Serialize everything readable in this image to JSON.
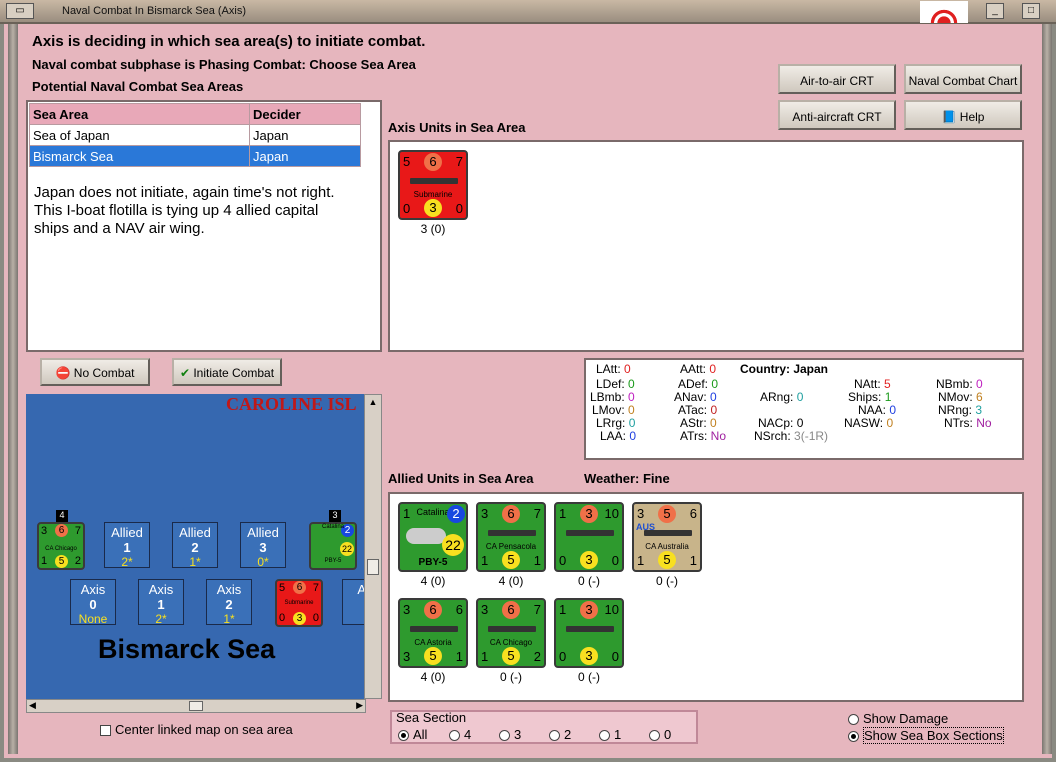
{
  "window": {
    "title": "Naval Combat In Bismarck Sea (Axis)"
  },
  "header": {
    "line1": "Axis is deciding in which sea area(s) to initiate combat.",
    "line2": "Naval combat subphase is Phasing Combat: Choose Sea Area",
    "line3": "Potential Naval Combat Sea Areas"
  },
  "buttons": {
    "air_to_air": "Air-to-air CRT",
    "naval_chart": "Naval Combat Chart",
    "anti_aircraft": "Anti-aircraft CRT",
    "help": "Help",
    "no_combat": "No Combat",
    "initiate": "Initiate Combat"
  },
  "sea_table": {
    "headers": [
      "Sea Area",
      "Decider"
    ],
    "rows": [
      [
        "Sea of Japan",
        "Japan"
      ],
      [
        "Bismarck Sea",
        "Japan"
      ]
    ]
  },
  "note": "Japan does not initiate, again time's not right.  This I-boat flotilla is tying up 4 allied capital ships and a NAV air wing.",
  "axis_units": {
    "label": "Axis Units in Sea Area",
    "sub": {
      "top": [
        "5",
        "6",
        "7"
      ],
      "name": "Submarine",
      "bottom": [
        "0",
        "3",
        "0"
      ],
      "caption": "3 (0)"
    }
  },
  "stats": {
    "rows": [
      [
        "LAtt:",
        "0",
        "AAtt:",
        "0",
        "Country: Japan",
        "",
        "",
        ""
      ],
      [
        "LDef:",
        "0",
        "ADef:",
        "0",
        "",
        "",
        "NAtt:",
        "5",
        "NBmb:",
        "0"
      ]
    ],
    "latt": "LAtt:",
    "latt_v": "0",
    "aatt": "AAtt:",
    "aatt_v": "0",
    "country": "Country: Japan",
    "ldef": "LDef:",
    "ldef_v": "0",
    "adef": "ADef:",
    "adef_v": "0",
    "natt": "NAtt:",
    "natt_v": "5",
    "nbmb": "NBmb:",
    "nbmb_v": "0",
    "lbmb": "LBmb:",
    "lbmb_v": "0",
    "anav": "ANav:",
    "anav_v": "0",
    "arng": "ARng:",
    "arng_v": "0",
    "ships": "Ships:",
    "ships_v": "1",
    "nmov": "NMov:",
    "nmov_v": "6",
    "lmov": "LMov:",
    "lmov_v": "0",
    "atac": "ATac:",
    "atac_v": "0",
    "naa": "NAA:",
    "naa_v": "0",
    "nrng": "NRng:",
    "nrng_v": "3",
    "lrng": "LRrg:",
    "lrng_v": "0",
    "astr": "AStr:",
    "astr_v": "0",
    "nacp": "NACp:",
    "nacp_v": "0",
    "nasw": "NASW:",
    "nasw_v": "0",
    "ntrs": "NTrs:",
    "ntrs_v": "No",
    "laa": "LAA:",
    "laa_v": "0",
    "atrs": "ATrs:",
    "atrs_v": "No",
    "nsrch": "NSrch:",
    "nsrch_v": "3(-1R)"
  },
  "allied": {
    "label": "Allied Units in Sea Area",
    "weather": "Weather:  Fine",
    "units": [
      {
        "name": "PBY-5",
        "title": "Catalina",
        "top": [
          "1",
          "",
          "2"
        ],
        "bottom": [
          "",
          "22",
          ""
        ],
        "caption": "4 (0)"
      },
      {
        "name": "CA Pensacola",
        "top": [
          "3",
          "6",
          "7"
        ],
        "bottom": [
          "1",
          "5",
          "1"
        ],
        "caption": "4 (0)"
      },
      {
        "name": "",
        "top": [
          "1",
          "3",
          "10"
        ],
        "bottom": [
          "0",
          "3",
          "0"
        ],
        "caption": "0 (-)"
      },
      {
        "name": "CA Australia",
        "flag": "AUS",
        "top": [
          "3",
          "5",
          "6"
        ],
        "bottom": [
          "1",
          "5",
          "1"
        ],
        "caption": "0 (-)"
      },
      {
        "name": "CA Astoria",
        "top": [
          "3",
          "6",
          "6"
        ],
        "bottom": [
          "3",
          "5",
          "1"
        ],
        "caption": "4 (0)"
      },
      {
        "name": "CA Chicago",
        "top": [
          "3",
          "6",
          "7"
        ],
        "bottom": [
          "1",
          "5",
          "2"
        ],
        "caption": "0 (-)"
      },
      {
        "name": "",
        "top": [
          "1",
          "3",
          "10"
        ],
        "bottom": [
          "0",
          "3",
          "0"
        ],
        "caption": "0 (-)"
      }
    ]
  },
  "map": {
    "region": "CAROLINE ISL",
    "sea": "Bismarck Sea",
    "allied_boxes": [
      {
        "t": "Allied",
        "n": "1",
        "v": "2*"
      },
      {
        "t": "Allied",
        "n": "2",
        "v": "1*"
      },
      {
        "t": "Allied",
        "n": "3",
        "v": "0*"
      }
    ],
    "axis_boxes": [
      {
        "t": "Axis",
        "n": "0",
        "v": "None"
      },
      {
        "t": "Axis",
        "n": "1",
        "v": "2*"
      },
      {
        "t": "Axis",
        "n": "2",
        "v": "1*"
      },
      {
        "t": "Ax",
        "n": "",
        "v": ""
      }
    ],
    "stack_left": "4",
    "stack_right": "3",
    "left_counter": {
      "top": [
        "3",
        "6",
        "7"
      ],
      "name": "CA Chicago",
      "bottom": [
        "1",
        "5",
        "2"
      ]
    },
    "right_counter": {
      "title": "Catalina",
      "top": [
        "",
        "",
        "2"
      ],
      "name": "PBY-5",
      "bottom": [
        "",
        "22",
        ""
      ]
    },
    "sub_counter": {
      "top": [
        "5",
        "6",
        "7"
      ],
      "name": "Submarine",
      "bottom": [
        "0",
        "3",
        "0"
      ]
    }
  },
  "center_map": "Center linked map on sea area",
  "sea_section": {
    "label": "Sea Section",
    "options": [
      "All",
      "4",
      "3",
      "2",
      "1",
      "0"
    ],
    "selected": "All"
  },
  "show_damage": "Show Damage",
  "show_sections": "Show Sea Box Sections",
  "colors": {
    "bg": "#e6b6be",
    "green": "#2e9a2e",
    "red": "#e81818",
    "tan": "#c8b48a",
    "select": "#2a78d8"
  }
}
